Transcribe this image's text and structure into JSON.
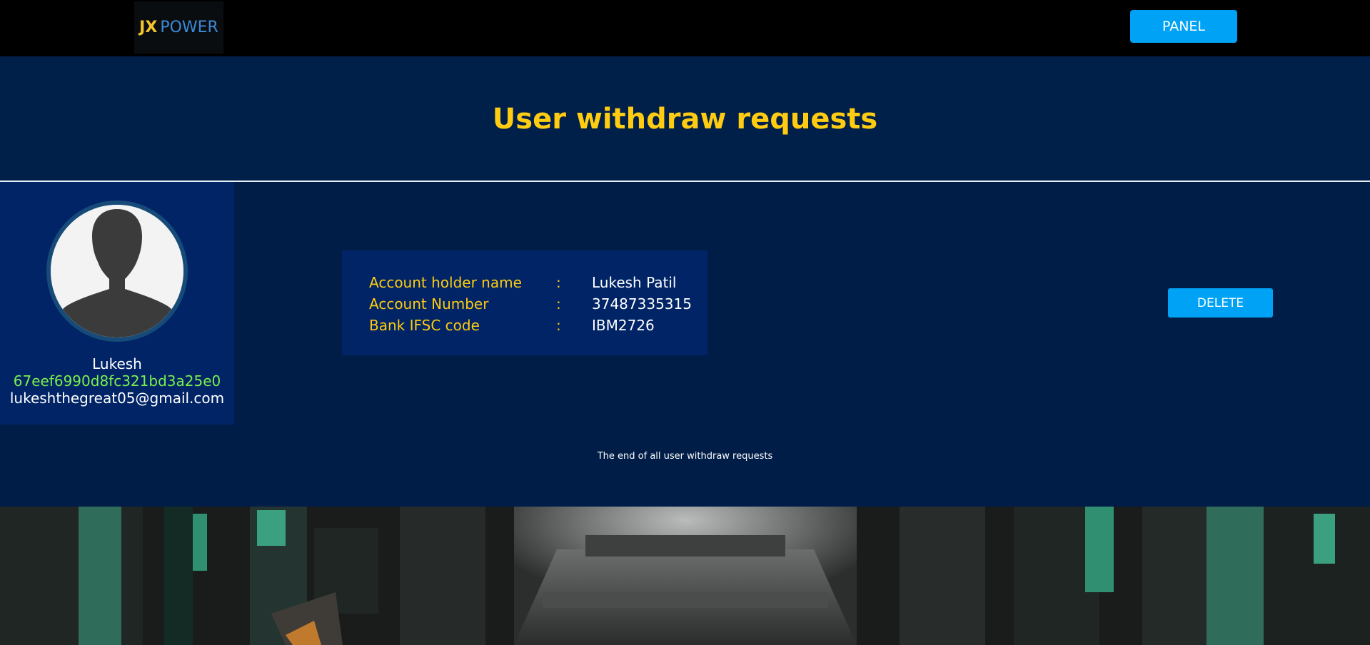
{
  "logo": {
    "part1": "JX",
    "part2": "POWER"
  },
  "nav": {
    "panel_label": "PANEL"
  },
  "page": {
    "title": "User withdraw requests"
  },
  "request": {
    "user": {
      "name": "Lukesh",
      "id": "67eef6990d8fc321bd3a25e0",
      "email": "lukeshthegreat05@gmail.com"
    },
    "bank": {
      "rows": [
        {
          "label": "Account holder name",
          "separator": ":",
          "value": "Lukesh Patil"
        },
        {
          "label": "Account Number",
          "separator": ":",
          "value": "37487335315"
        },
        {
          "label": "Bank IFSC code",
          "separator": ":",
          "value": "IBM2726"
        }
      ]
    },
    "delete_label": "DELETE"
  },
  "footer_note": "The end of all user withdraw requests",
  "colors": {
    "accent_yellow": "#ffcc11",
    "button_blue": "#00a2f5",
    "user_id_green": "#7cf04c",
    "page_bg": "#001d47",
    "card_bg": "#002466"
  },
  "icons": {
    "avatar": "default-user-silhouette-icon"
  }
}
